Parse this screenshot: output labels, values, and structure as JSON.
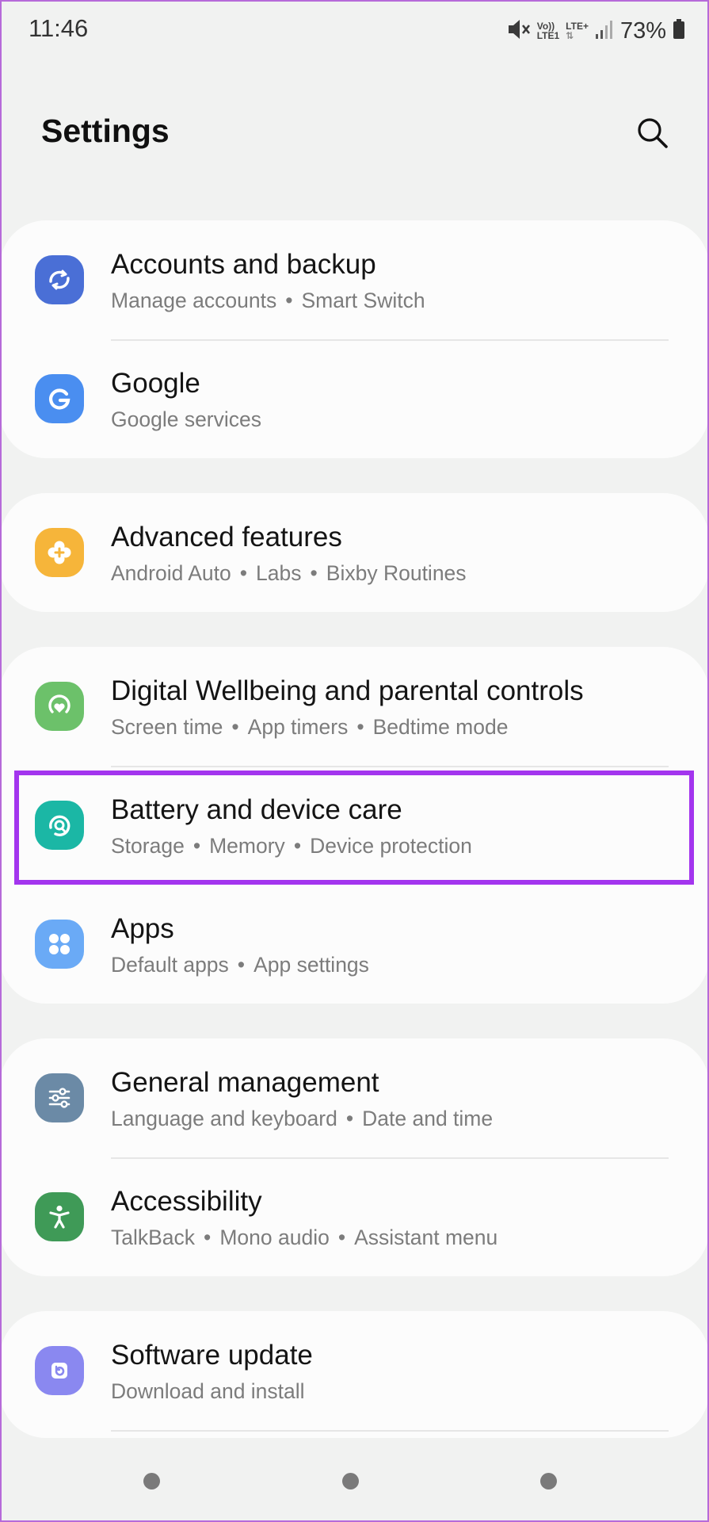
{
  "status_bar": {
    "time": "11:46",
    "volte": "Vo))",
    "lte1": "LTE1",
    "lte_plus": "LTE+",
    "battery_percent": "73%",
    "icons": [
      "mute-icon",
      "signal-icon",
      "battery-icon"
    ]
  },
  "header": {
    "title": "Settings",
    "search_icon": "search-icon"
  },
  "items": [
    {
      "title": "Accounts and backup",
      "subtitle": [
        "Manage accounts",
        "Smart Switch"
      ],
      "icon": "sync-icon",
      "icon_color": "#4a6fd6"
    },
    {
      "title": "Google",
      "subtitle": [
        "Google services"
      ],
      "icon": "google-g-icon",
      "icon_color": "#4a8ef0"
    },
    {
      "title": "Advanced features",
      "subtitle": [
        "Android Auto",
        "Labs",
        "Bixby Routines"
      ],
      "icon": "puzzle-plus-icon",
      "icon_color": "#f6b53a"
    },
    {
      "title": "Digital Wellbeing and parental controls",
      "subtitle": [
        "Screen time",
        "App timers",
        "Bedtime mode"
      ],
      "icon": "heart-ring-icon",
      "icon_color": "#6cc16a"
    },
    {
      "title": "Battery and device care",
      "subtitle": [
        "Storage",
        "Memory",
        "Device protection"
      ],
      "icon": "device-care-icon",
      "icon_color": "#1bb7a5",
      "highlighted": true
    },
    {
      "title": "Apps",
      "subtitle": [
        "Default apps",
        "App settings"
      ],
      "icon": "apps-grid-icon",
      "icon_color": "#6aaaf6"
    },
    {
      "title": "General management",
      "subtitle": [
        "Language and keyboard",
        "Date and time"
      ],
      "icon": "sliders-icon",
      "icon_color": "#6b8aa6"
    },
    {
      "title": "Accessibility",
      "subtitle": [
        "TalkBack",
        "Mono audio",
        "Assistant menu"
      ],
      "icon": "accessibility-person-icon",
      "icon_color": "#3f9a57"
    },
    {
      "title": "Software update",
      "subtitle": [
        "Download and install"
      ],
      "icon": "software-update-icon",
      "icon_color": "#8a88f0"
    }
  ],
  "colors": {
    "background": "#f1f2f1",
    "card": "#fcfcfc",
    "highlight_border": "#a335ee",
    "subtitle_text": "#7c7c7c"
  },
  "nav_bar": {
    "buttons": [
      "recent-apps",
      "home",
      "back"
    ]
  }
}
